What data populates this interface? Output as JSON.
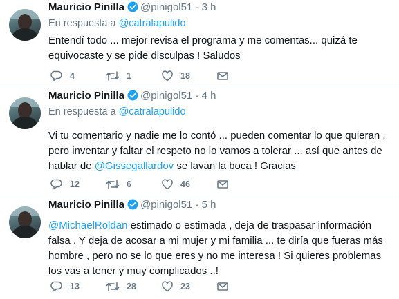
{
  "tweets": [
    {
      "name": "Mauricio Pinilla",
      "handle": "@pinigol51",
      "dot": "·",
      "time": "3 h",
      "reply_prefix": "En respuesta a",
      "reply_to": "@catralapulido",
      "text_before": "Entendí todo ... mejor revisa el programa y me comentas... quizá te equivocaste y se pide disculpas ! Saludos",
      "mention": "",
      "text_after": "",
      "replies": "4",
      "retweets": "1",
      "likes": "18"
    },
    {
      "name": "Mauricio Pinilla",
      "handle": "@pinigol51",
      "dot": "·",
      "time": "4 h",
      "reply_prefix": "En respuesta a",
      "reply_to": "@catralapulido",
      "text_before": "Vi tu comentario y nadie me lo contó ... pueden comentar lo que quieran , pero inventar y faltar el respeto no lo vamos a tolerar ... así que antes de hablar de ",
      "mention": "@Gissegallardov",
      "text_after": " se lavan la boca ! Gracias",
      "replies": "12",
      "retweets": "6",
      "likes": "46"
    },
    {
      "name": "Mauricio Pinilla",
      "handle": "@pinigol51",
      "dot": "·",
      "time": "5 h",
      "reply_prefix": "",
      "reply_to": "",
      "text_before": "",
      "mention": "@MichaelRoldan",
      "text_after": " estimado o estimada , deja de traspasar información falsa . Y deja de acosar a mi mujer y mi familia ... te diría que fueras más hombre , pero no se lo que eres y no me interesa ! Si quieres problemas los vas a tener y muy complicados ..!",
      "replies": "13",
      "retweets": "28",
      "likes": "23"
    }
  ],
  "colors": {
    "link": "#1da1f2",
    "muted": "#657786",
    "verified": "#1da1f2"
  },
  "icons": [
    "reply-icon",
    "retweet-icon",
    "like-icon",
    "dm-icon",
    "verified-icon"
  ]
}
